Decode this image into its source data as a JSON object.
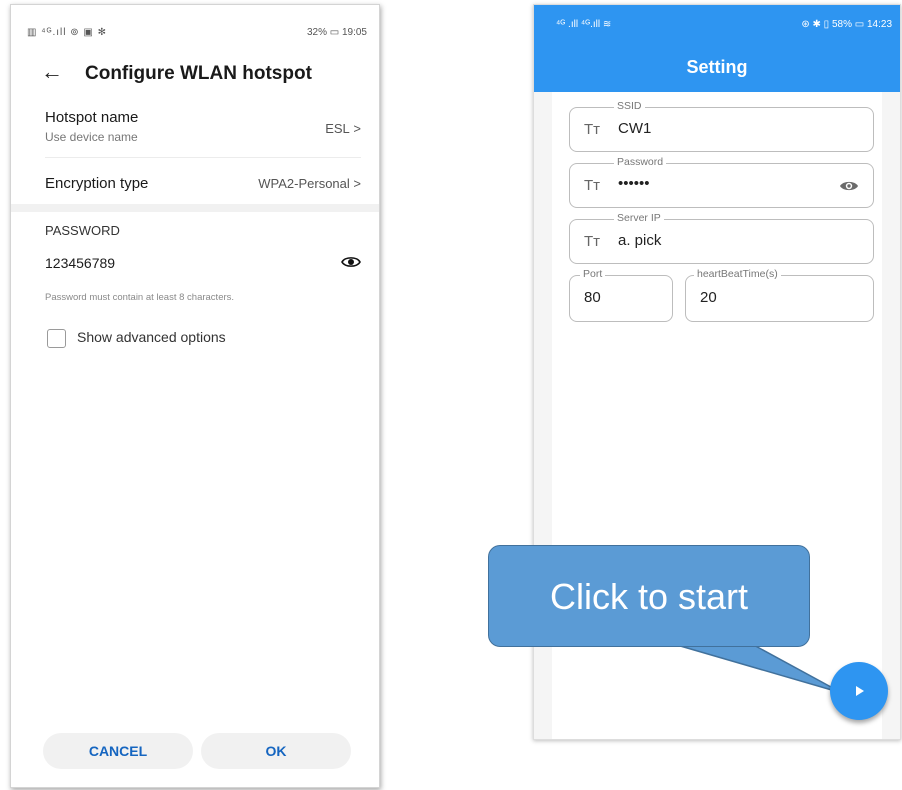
{
  "left_phone": {
    "status": {
      "left_icons": "▥ ⁴ᴳ.ıll ⊚ ▣ ✻",
      "right": "32% ▭ 19:05"
    },
    "header": {
      "back_glyph": "←",
      "title": "Configure WLAN hotspot"
    },
    "hotspot_name": {
      "label": "Hotspot name",
      "sub": "Use device name",
      "value": "ESL",
      "chevron": ">"
    },
    "encryption": {
      "label": "Encryption type",
      "value": "WPA2-Personal",
      "chevron": ">"
    },
    "password_section": {
      "title": "PASSWORD",
      "value": "123456789",
      "hint": "Password must contain at least 8 characters."
    },
    "advanced": {
      "label": "Show advanced options"
    },
    "buttons": {
      "cancel": "CANCEL",
      "ok": "OK"
    },
    "accent_color": "#1565c0"
  },
  "right_phone": {
    "status": {
      "left": "⁴ᴳ .ıll ⁴ᴳ.ıll ≋",
      "right": "⊛ ✱ ▯ 58% ▭ 14:23"
    },
    "title": "Setting",
    "fields": {
      "ssid": {
        "label": "SSID",
        "value": "CW1"
      },
      "password": {
        "label": "Password",
        "value": "••••••"
      },
      "server_ip": {
        "label": "Server IP",
        "value": "a. pick"
      },
      "port": {
        "label": "Port",
        "value": "80"
      },
      "heartbeat": {
        "label": "heartBeatTime(s)",
        "value": "20"
      }
    },
    "text_type_glyph": "Tт",
    "accent_color": "#2e95f1"
  },
  "callout": {
    "text": "Click to start",
    "color": "#5b9bd5"
  },
  "fab": {
    "icon": "play-icon"
  }
}
